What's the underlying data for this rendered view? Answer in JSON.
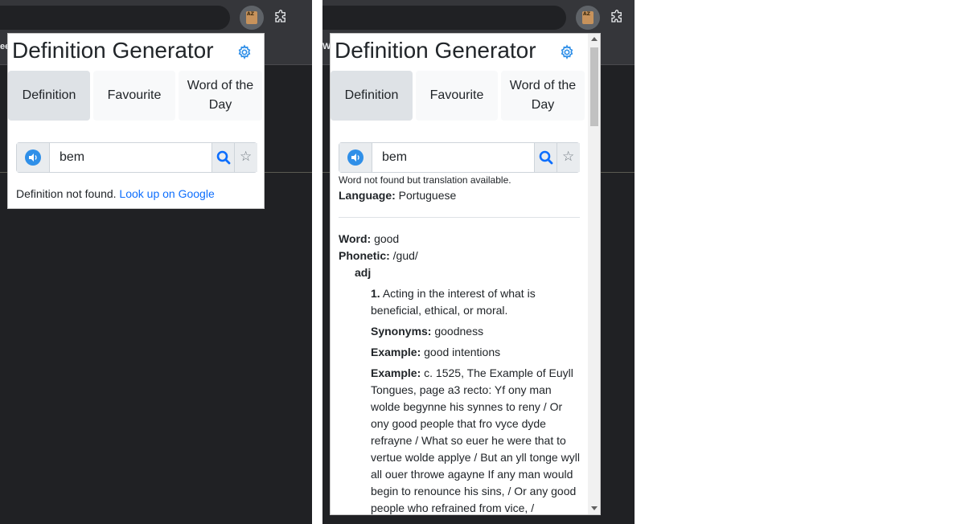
{
  "tab_fragments": {
    "left": "ee",
    "right": "Wo"
  },
  "popup": {
    "title": "Definition Generator",
    "tabs": [
      "Definition",
      "Favourite",
      "Word of the Day"
    ],
    "search_value": "bem"
  },
  "left_result": {
    "message": "Definition not found.",
    "link": "Look up on Google"
  },
  "right_result": {
    "note": "Word not found but translation available.",
    "language_label": "Language:",
    "language_value": "Portuguese",
    "word_label": "Word:",
    "word_value": "good",
    "phonetic_label": "Phonetic:",
    "phonetic_value": "/gud/",
    "part_of_speech": "adj",
    "definition_number": "1.",
    "definition_text": "Acting in the interest of what is beneficial, ethical, or moral.",
    "synonyms_label": "Synonyms:",
    "synonyms_value": "goodness",
    "example1_label": "Example:",
    "example1_value": "good intentions",
    "example2_label": "Example:",
    "example2_value": "c. 1525, The Example of Euyll Tongues, page a3 recto: Yf ony man wolde begynne his synnes to reny / Or ony good people that fro vyce dyde refrayne / What so euer he were that to vertue wolde applye / But an yll tonge wyll all ouer throwe agayne If any man would begin to renounce his sins, / Or any good people who refrained from vice, /"
  },
  "icons": {
    "extension": "book-az-icon",
    "puzzle": "puzzle-icon",
    "settings": "gear-icon",
    "speak": "speaker-icon",
    "search": "search-icon",
    "star": "star-icon"
  },
  "colors": {
    "accent": "#0d6efd",
    "icon_blue": "#2f8fe8",
    "active_tab": "#dee2e6",
    "browser_bg": "#202124"
  }
}
